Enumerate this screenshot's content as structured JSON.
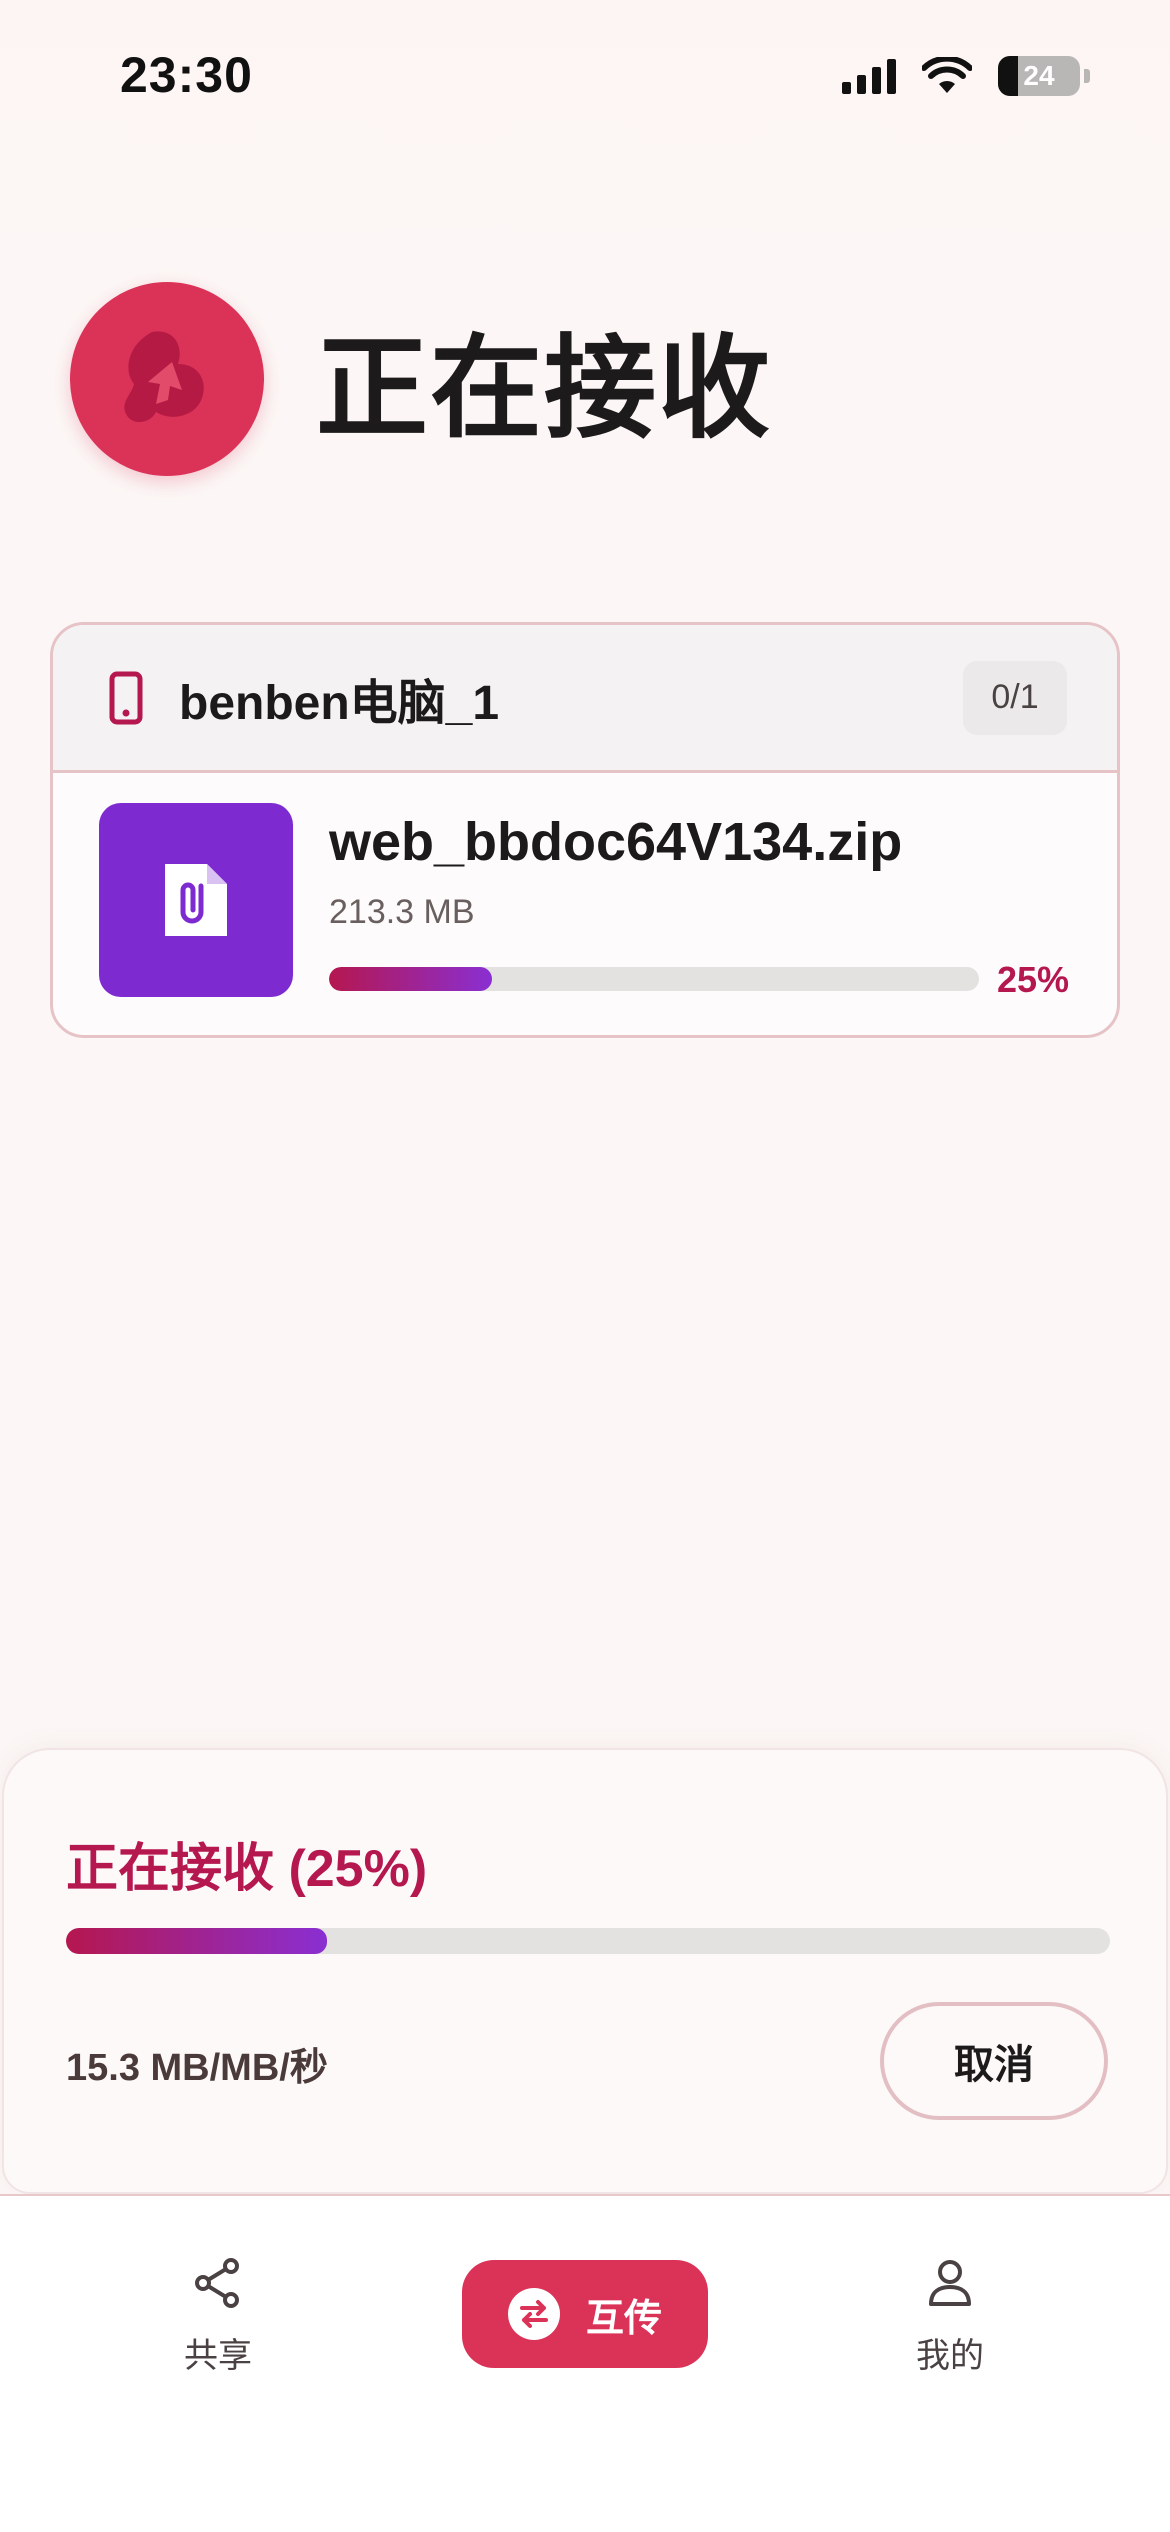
{
  "status_bar": {
    "time": "23:30",
    "battery": "24",
    "battery_level": 0.24
  },
  "header": {
    "title": "正在接收"
  },
  "transfer": {
    "device_name": "benben电脑_1",
    "count": "0/1",
    "file": {
      "name": "web_bbdoc64V134.zip",
      "size": "213.3 MB",
      "progress": 0.25,
      "percent_label": "25%"
    }
  },
  "sheet": {
    "title": "正在接收 (25%)",
    "progress": 0.25,
    "speed": "15.3 MB/MB/秒",
    "cancel_label": "取消"
  },
  "nav": {
    "share_label": "共享",
    "transfer_label": "互传",
    "mine_label": "我的"
  },
  "colors": {
    "accent": "#db3358",
    "accent_dark": "#b5174f",
    "file_icon_bg": "#7d2ad0",
    "card_border": "#e6c3c6"
  },
  "icons": {
    "status": [
      "signal-icon",
      "wifi-icon",
      "battery-icon"
    ],
    "header": "app-logo-icon",
    "device": "phone-icon",
    "file": "attachment-file-icon",
    "nav": [
      "share-icon",
      "swap-icon",
      "user-icon"
    ]
  }
}
